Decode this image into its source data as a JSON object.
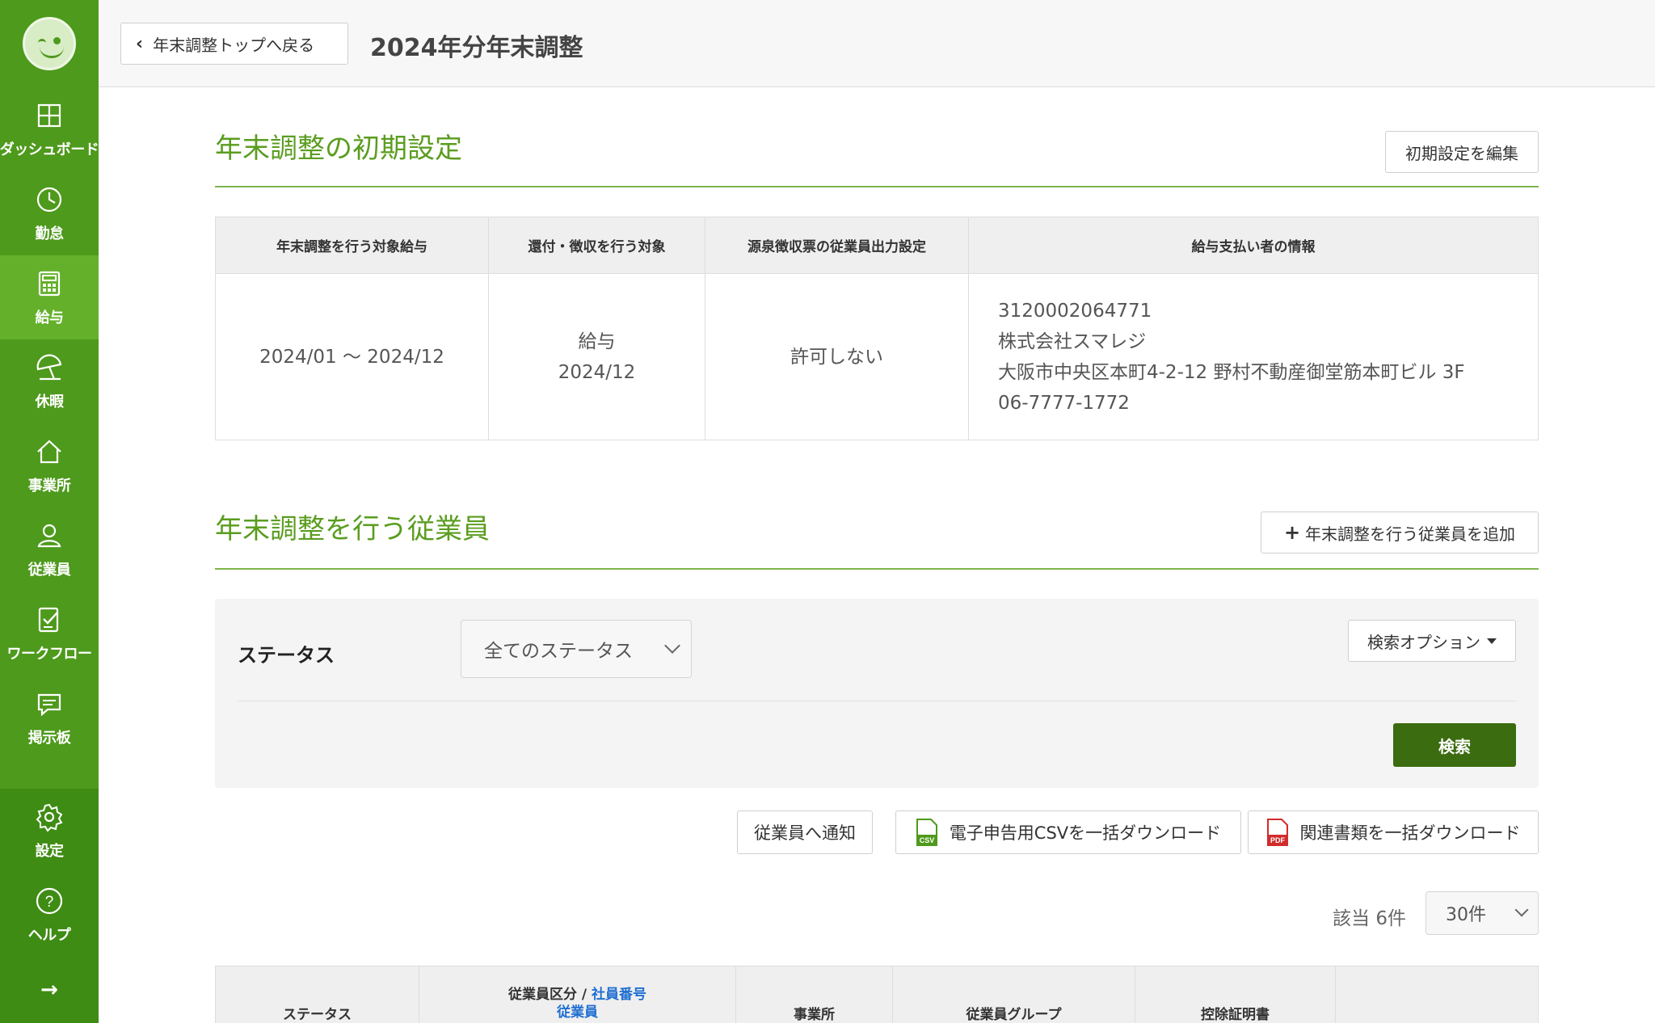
{
  "sidebar": {
    "items": [
      {
        "label": "ダッシュボード",
        "icon": "dashboard-icon"
      },
      {
        "label": "勤怠",
        "icon": "clock-icon"
      },
      {
        "label": "給与",
        "icon": "calculator-icon",
        "active": true
      },
      {
        "label": "休暇",
        "icon": "beach-umbrella-icon"
      },
      {
        "label": "事業所",
        "icon": "home-icon"
      },
      {
        "label": "従業員",
        "icon": "person-icon"
      },
      {
        "label": "ワークフロー",
        "icon": "checklist-icon"
      },
      {
        "label": "掲示板",
        "icon": "chat-icon"
      }
    ],
    "bottom": [
      {
        "label": "設定",
        "icon": "gear-icon"
      },
      {
        "label": "ヘルプ",
        "icon": "help-icon"
      }
    ],
    "collapse_arrow": "→"
  },
  "header": {
    "back_label": "年末調整トップへ戻る",
    "title": "2024年分年末調整"
  },
  "initial": {
    "title": "年末調整の初期設定",
    "edit_label": "初期設定を編集",
    "columns": [
      "年末調整を行う対象給与",
      "還付・徴収を行う対象",
      "源泉徴収票の従業員出力設定",
      "給与支払い者の情報"
    ],
    "period": "2024/01 〜 2024/12",
    "target_line1": "給与",
    "target_line2": "2024/12",
    "output_setting": "許可しない",
    "payer_id": "3120002064771",
    "payer_name": "株式会社スマレジ",
    "payer_address": "大阪市中央区本町4-2-12 野村不動産御堂筋本町ビル 3F",
    "payer_phone": "06-7777-1772"
  },
  "employees": {
    "title": "年末調整を行う従業員",
    "add_label": "年末調整を行う従業員を追加",
    "filter_label": "ステータス",
    "status_value": "全てのステータス",
    "search_option_label": "検索オプション",
    "search_label": "検索",
    "notify_label": "従業員へ通知",
    "csv_label": "電子申告用CSVを一括ダウンロード",
    "pdf_label": "関連書類を一括ダウンロード",
    "count_text": "該当 6件",
    "per_page": "30件",
    "list_columns": {
      "status": "ステータス",
      "type": "従業員区分",
      "sep": " / ",
      "emp_no": "社員番号",
      "employee": "従業員",
      "office": "事業所",
      "group": "従業員グループ",
      "cert": "控除証明書"
    }
  },
  "colors": {
    "sidebar": "#4e9a1c",
    "sidebar_active": "#64b02a",
    "section_title": "#5a9d1f",
    "primary_button": "#3b6c0f",
    "link": "#1f6fd1"
  }
}
